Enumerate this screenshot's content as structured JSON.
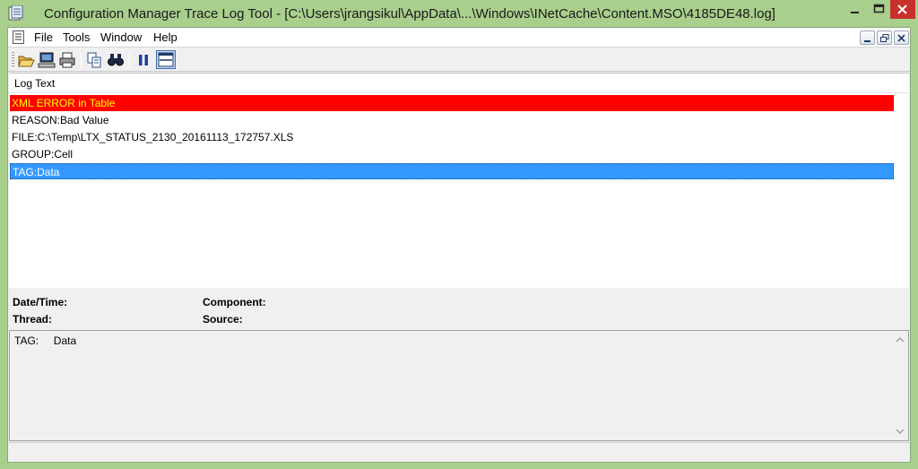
{
  "window": {
    "title": "Configuration Manager Trace Log Tool - [C:\\Users\\jrangsikul\\AppData\\...\\Windows\\INetCache\\Content.MSO\\4185DE48.log]"
  },
  "menu": {
    "items": [
      "File",
      "Tools",
      "Window",
      "Help"
    ]
  },
  "toolbar": {
    "buttons": [
      "open-icon",
      "computer-icon",
      "print-icon",
      "copy-icon",
      "find-icon",
      "pause-icon",
      "preview-pane-icon"
    ]
  },
  "log": {
    "column_header": "Log Text",
    "rows": [
      {
        "text": "XML ERROR in Table",
        "status": "error"
      },
      {
        "text": "REASON:Bad Value",
        "status": "normal"
      },
      {
        "text": "FILE:C:\\Temp\\LTX_STATUS_2130_20161113_172757.XLS",
        "status": "normal"
      },
      {
        "text": "GROUP:Cell",
        "status": "normal"
      },
      {
        "text": "TAG:Data",
        "status": "selected"
      }
    ]
  },
  "details": {
    "datetime_label": "Date/Time:",
    "component_label": "Component:",
    "thread_label": "Thread:",
    "source_label": "Source:"
  },
  "message": {
    "text": "TAG:     Data"
  },
  "colors": {
    "frame": "#a9cf8c",
    "error_bg": "#ff0000",
    "error_fg": "#ffff00",
    "selected_bg": "#3399ff",
    "close_button": "#c7312c"
  }
}
